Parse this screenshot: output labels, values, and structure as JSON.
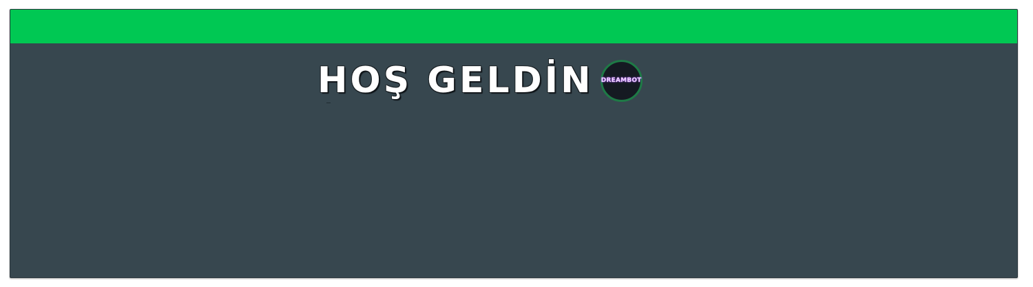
{
  "banner": {
    "welcome_text": "HOŞ GELDİN",
    "avatar_label": "DREAMBOT"
  },
  "colors": {
    "accent_bar": "#00c853",
    "panel_background": "#37474f",
    "avatar_background": "#151a22",
    "avatar_border": "#1e7a46"
  }
}
